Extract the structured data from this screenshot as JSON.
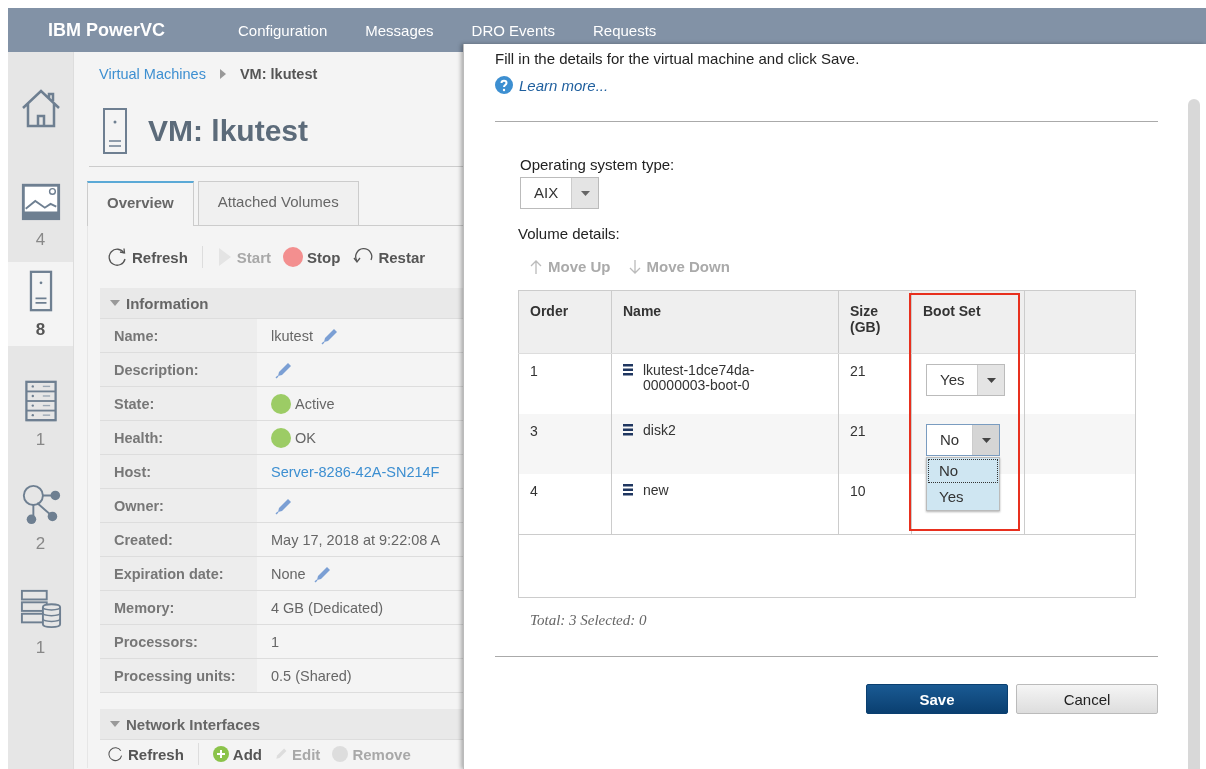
{
  "top_bar": {
    "brand": "IBM PowerVC",
    "nav": [
      {
        "label": "Configuration"
      },
      {
        "label": "Messages"
      },
      {
        "label": "DRO Events"
      },
      {
        "label": "Requests"
      }
    ]
  },
  "rail": [
    {
      "kind": "home",
      "selected": false
    },
    {
      "kind": "image",
      "count": "4",
      "selected": false
    },
    {
      "kind": "vm",
      "count": "8",
      "selected": true
    },
    {
      "kind": "host",
      "count": "1",
      "selected": false
    },
    {
      "kind": "network",
      "count": "2",
      "selected": false
    },
    {
      "kind": "storage",
      "count": "1",
      "selected": false
    }
  ],
  "breadcrumb": {
    "parent": "Virtual Machines",
    "current": "VM: lkutest"
  },
  "title": "VM: lkutest",
  "tabs": [
    {
      "label": "Overview",
      "selected": true
    },
    {
      "label": "Attached Volumes",
      "selected": false
    }
  ],
  "toolbar": [
    {
      "kind": "refresh",
      "label": "Refresh",
      "disabled": false
    },
    {
      "kind": "start",
      "label": "Start",
      "disabled": true
    },
    {
      "kind": "stop",
      "label": "Stop",
      "disabled": false
    },
    {
      "kind": "restart",
      "label": "Restar",
      "disabled": false
    }
  ],
  "information": {
    "title": "Information",
    "expanded": true,
    "rows": [
      {
        "label": "Name:",
        "value": "lkutest",
        "editable": true
      },
      {
        "label": "Description:",
        "editable": true
      },
      {
        "label": "State:",
        "value": "Active",
        "color": "#9ccc65"
      },
      {
        "label": "Health:",
        "value": "OK",
        "color": "#9ccc65"
      },
      {
        "label": "Host:",
        "value": "Server-8286-42A-SN214F",
        "link": true
      },
      {
        "label": "Owner:",
        "editable": true
      },
      {
        "label": "Created:",
        "value": "May 17, 2018 at 9:22:08 A"
      },
      {
        "label": "Expiration date:",
        "value": "None",
        "editable": true
      },
      {
        "label": "Memory:",
        "value": "4 GB (Dedicated)"
      },
      {
        "label": "Processors:",
        "value": "1"
      },
      {
        "label": "Processing units:",
        "value": "0.5 (Shared)"
      }
    ]
  },
  "network_interfaces": {
    "title": "Network Interfaces",
    "expanded": true,
    "toolbar": [
      {
        "kind": "refresh",
        "label": "Refresh",
        "disabled": false
      },
      {
        "kind": "add",
        "label": "Add",
        "disabled": false
      },
      {
        "kind": "edit",
        "label": "Edit",
        "disabled": true
      },
      {
        "kind": "remove",
        "label": "Remove",
        "disabled": true
      }
    ]
  },
  "dialog": {
    "intro": "Fill in the details for the virtual machine and click Save.",
    "learn_more": "Learn more...",
    "os_label": "Operating system type:",
    "os_value": "AIX",
    "volume_label": "Volume details:",
    "move_buttons": [
      {
        "kind": "up",
        "label": "Move Up",
        "disabled": true
      },
      {
        "kind": "down",
        "label": "Move Down",
        "disabled": true
      }
    ],
    "columns": [
      "Order",
      "Name",
      "Size (GB)",
      "Boot Set"
    ],
    "rows": [
      {
        "order": "1",
        "name": "lkutest-1dce74da-00000003-boot-0",
        "size": "21",
        "boot_set": "Yes"
      },
      {
        "order": "3",
        "name": "disk2",
        "size": "21",
        "boot_set": "No",
        "open": true,
        "options": [
          {
            "label": "No",
            "selected": true
          },
          {
            "label": "Yes",
            "selected": false
          }
        ]
      },
      {
        "order": "4",
        "name": "new",
        "size": "10"
      }
    ],
    "footer": "Total: 3 Selected: 0",
    "buttons": [
      {
        "label": "Save",
        "primary": true
      },
      {
        "label": "Cancel",
        "primary": false
      }
    ]
  }
}
